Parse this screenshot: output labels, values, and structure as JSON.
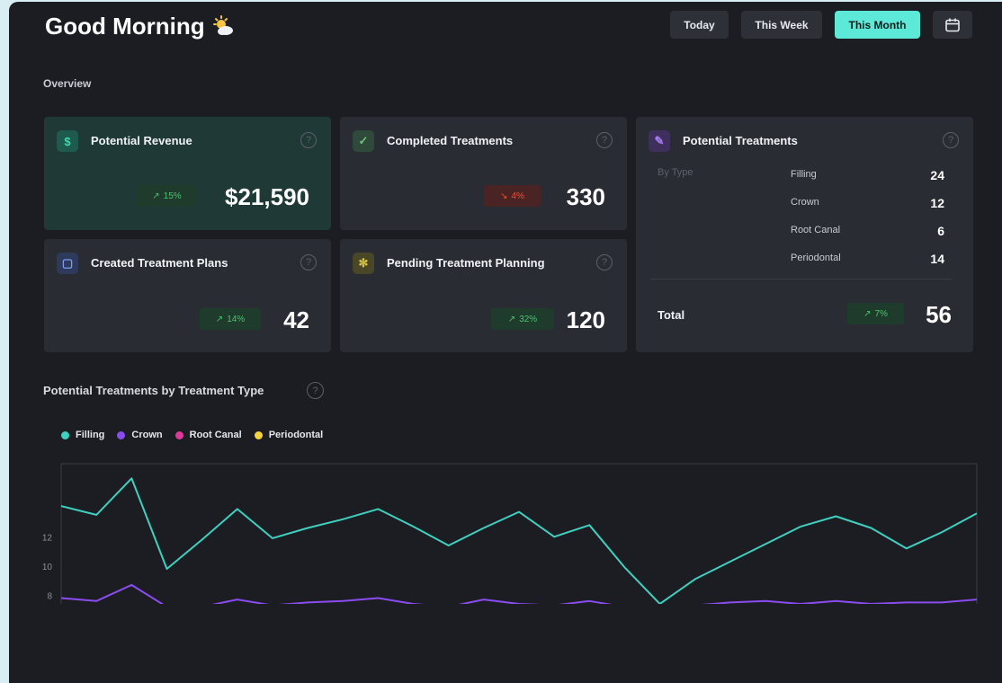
{
  "header": {
    "greeting": "Good Morning",
    "ranges": [
      "Today",
      "This Week",
      "This Month"
    ],
    "active_range": "This Month"
  },
  "overview": {
    "title": "Overview",
    "revenue": {
      "title": "Potential Revenue",
      "change": "15%",
      "value": "$21,590",
      "trend": "up",
      "icon": "dollar-icon"
    },
    "completed": {
      "title": "Completed Treatments",
      "change": "4%",
      "value": "330",
      "trend": "down",
      "icon": "check-circle-icon"
    },
    "plans": {
      "title": "Created Treatment Plans",
      "change": "14%",
      "value": "42",
      "trend": "up",
      "icon": "document-icon"
    },
    "pending": {
      "title": "Pending Treatment Planning",
      "change": "32%",
      "value": "120",
      "trend": "up",
      "icon": "pending-gear-icon"
    },
    "potential": {
      "title": "Potential Treatments",
      "by_type_label": "By Type",
      "types": [
        {
          "name": "Filling",
          "value": "24"
        },
        {
          "name": "Crown",
          "value": "12"
        },
        {
          "name": "Root Canal",
          "value": "6"
        },
        {
          "name": "Periodontal",
          "value": "14"
        }
      ],
      "total_label": "Total",
      "total_change": "7%",
      "total_value": "56",
      "icon": "pen-icon"
    }
  },
  "chart_section": {
    "title": "Potential Treatments by Treatment Type"
  },
  "colors": {
    "filling": "#3fd0c0",
    "crown": "#8a4cf0",
    "root_canal": "#e0389a",
    "periodontal": "#f5d33a",
    "accent": "#5ce9d8"
  },
  "chart_data": {
    "type": "line",
    "x": [
      1,
      2,
      3,
      4,
      5,
      6,
      7,
      8,
      9,
      10,
      11,
      12,
      13,
      14,
      15,
      16,
      17,
      18,
      19,
      20,
      21,
      22,
      23,
      24,
      25,
      26,
      27
    ],
    "ylim": [
      7.4,
      17
    ],
    "y_ticks": [
      "12",
      "10",
      "8"
    ],
    "legend_position": "top-left",
    "series": [
      {
        "name": "Filling",
        "color": "#3fd0c0",
        "values": [
          14.1,
          13.5,
          16.0,
          9.8,
          11.8,
          13.9,
          11.9,
          12.6,
          13.2,
          13.9,
          12.7,
          11.4,
          12.6,
          13.7,
          12.0,
          12.8,
          9.9,
          7.4,
          9.1,
          10.3,
          11.5,
          12.7,
          13.4,
          12.6,
          11.2,
          12.3,
          13.6
        ],
        "visible_x": [
          1,
          2.58,
          3.58,
          5.13,
          7.47,
          8.49,
          11.47,
          13.51,
          15.45,
          16.53,
          17.59,
          18.54,
          19.12,
          23.37,
          25.47,
          27
        ]
      },
      {
        "name": "Crown",
        "color": "#8a4cf0",
        "values": [
          7.8,
          7.6,
          8.7,
          7.2,
          7.2,
          7.7,
          7.3,
          7.5,
          7.6,
          7.8,
          7.4,
          7.2,
          7.7,
          7.4,
          7.3,
          7.6,
          7.2,
          7.1,
          7.3,
          7.5,
          7.6,
          7.4,
          7.6,
          7.4,
          7.5,
          7.5,
          7.7
        ]
      },
      {
        "name": "Root Canal",
        "color": "#e0389a",
        "values": []
      },
      {
        "name": "Periodontal",
        "color": "#f5d33a",
        "values": []
      }
    ]
  }
}
